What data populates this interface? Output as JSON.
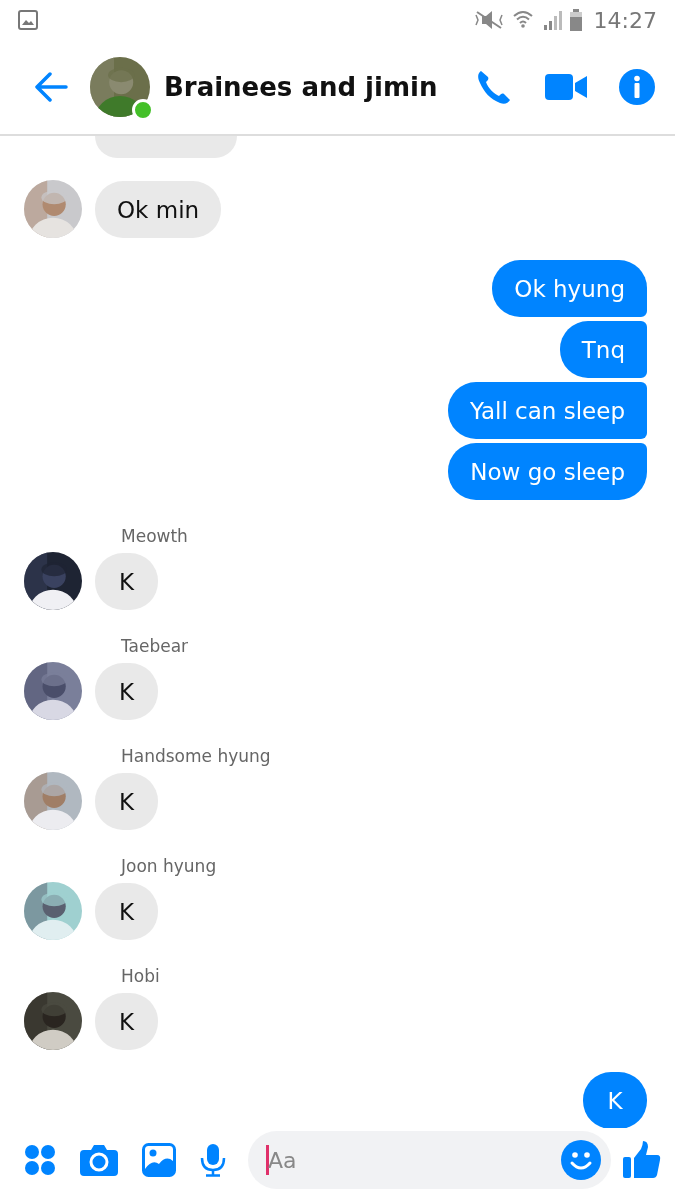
{
  "status_bar": {
    "time": "14:27"
  },
  "header": {
    "title": "Brainees and jimin",
    "online": true
  },
  "messages": [
    {
      "kind": "cut"
    },
    {
      "kind": "incoming",
      "text": "Ok min"
    },
    {
      "kind": "outgoing",
      "text": "Ok hyung"
    },
    {
      "kind": "outgoing",
      "text": "Tnq"
    },
    {
      "kind": "outgoing",
      "text": "Yall can sleep"
    },
    {
      "kind": "outgoing",
      "text": "Now go sleep"
    },
    {
      "kind": "incoming",
      "sender": "Meowth",
      "text": "K"
    },
    {
      "kind": "incoming",
      "sender": "Taebear",
      "text": "K"
    },
    {
      "kind": "incoming",
      "sender": "Handsome hyung",
      "text": "K"
    },
    {
      "kind": "incoming",
      "sender": "Joon hyung",
      "text": "K"
    },
    {
      "kind": "incoming",
      "sender": "Hobi",
      "text": "K"
    },
    {
      "kind": "outgoing",
      "text": "K"
    }
  ],
  "composer": {
    "placeholder": "Aa"
  }
}
